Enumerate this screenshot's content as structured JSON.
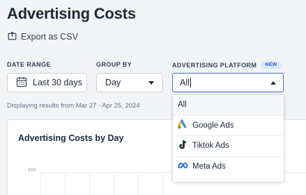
{
  "page": {
    "title": "Advertising Costs",
    "export_label": "Export as CSV"
  },
  "filters": {
    "date_range": {
      "label": "DATE RANGE",
      "value": "Last 30 days"
    },
    "group_by": {
      "label": "GROUP BY",
      "value": "Day"
    },
    "platform": {
      "label": "ADVERTISING PLATFORM",
      "badge": "NEW",
      "value": "All",
      "options": [
        {
          "label": "All",
          "icon": "none",
          "selected": true
        },
        {
          "label": "Google Ads",
          "icon": "google-ads-icon",
          "selected": false
        },
        {
          "label": "Tiktok Ads",
          "icon": "tiktok-icon",
          "selected": false
        },
        {
          "label": "Meta Ads",
          "icon": "meta-icon",
          "selected": false
        }
      ]
    },
    "range_note": "Displaying results from Mar 27 - Apr 25, 2024"
  },
  "chart": {
    "title": "Advertising Costs by Day",
    "y_tick": "£60"
  },
  "colors": {
    "focus_border": "#3b6fd8",
    "badge_bg": "#dbeafe",
    "badge_text": "#2563eb"
  }
}
